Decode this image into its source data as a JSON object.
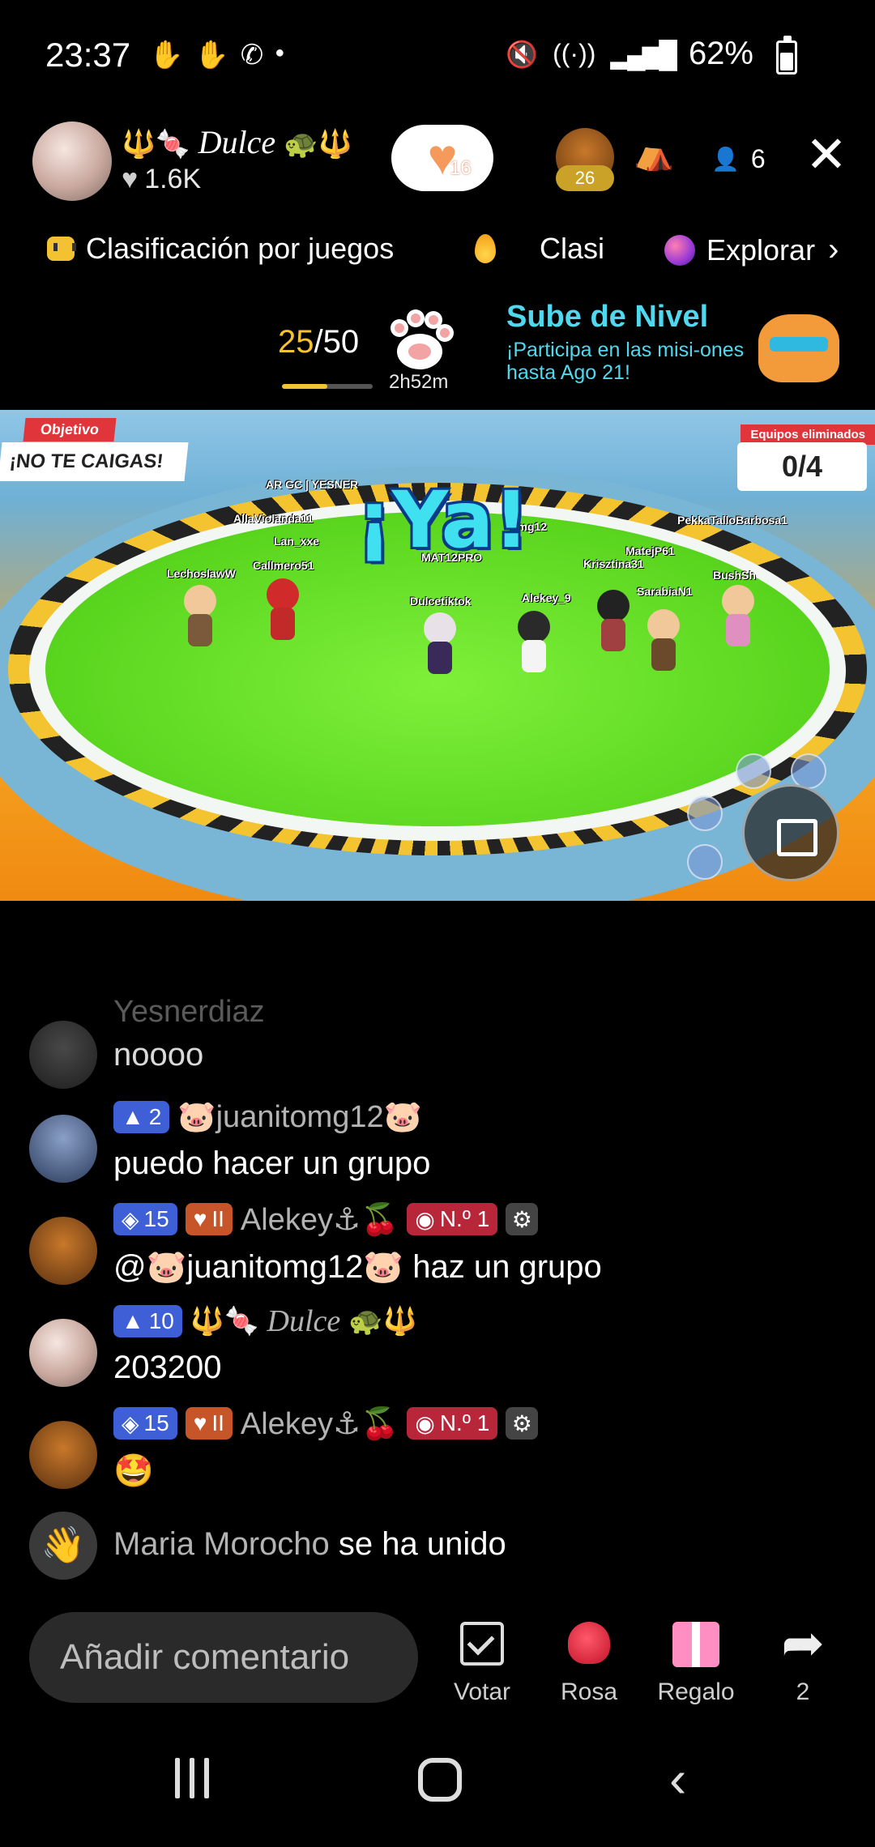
{
  "status_bar": {
    "time": "23:37",
    "left_icons": [
      "hand-icon",
      "hand-icon",
      "whatsapp-icon",
      "dot-icon"
    ],
    "battery": "62%",
    "battery_level_percent": 62
  },
  "header": {
    "host_name": "Dulce",
    "host_likes": "1.6K",
    "follow_badge_count": "16",
    "top_viewer_level": "26",
    "viewer_count": "6",
    "close_symbol": "✕"
  },
  "tabs": [
    {
      "label": "Clasificación por juegos",
      "icon": "gamepad-icon"
    },
    {
      "label": "Clasi",
      "icon": "fire-icon"
    },
    {
      "label": "Explorar",
      "icon": "planet-icon"
    }
  ],
  "progress": {
    "current": "25",
    "total": "/50",
    "fraction": 0.5,
    "timer": "2h52m",
    "promo_title": "Sube de Nivel",
    "promo_subtitle": "¡Participa en las misi-ones hasta Ago 21!"
  },
  "game": {
    "objective_label": "Objetivo",
    "objective_text": "¡NO TE CAIGAS!",
    "eliminated_label": "Equipos eliminados",
    "eliminated_value": "0/4",
    "go_text": "¡Ya!",
    "players": [
      "AR GC | YESNER",
      "AllaViolanda11",
      "Lan_xxe",
      "Callmero51",
      "LechoslawW",
      "MAT12PRO",
      "omg12",
      "Dulcetiktok",
      "Alekey_9",
      "Krisztina31",
      "MatejP61",
      "SarabiaN1",
      "PekkaTalloBarbosa1",
      "BushSh"
    ]
  },
  "chat": [
    {
      "user": "Yesnerdiaz",
      "text": "noooo",
      "badges": []
    },
    {
      "user": "🐷juanitomg12🐷",
      "text": "puedo hacer un grupo",
      "badges": [
        {
          "type": "level",
          "value": "2"
        }
      ]
    },
    {
      "user": "Alekey⚓🍒",
      "text": "@🐷juanitomg12🐷 haz un grupo",
      "badges": [
        {
          "type": "level",
          "value": "15"
        },
        {
          "type": "fan",
          "value": "II"
        },
        {
          "type": "rank",
          "value": "N.º 1"
        },
        {
          "type": "mod"
        }
      ]
    },
    {
      "user": "Dulce",
      "text": "203200",
      "badges": [
        {
          "type": "level",
          "value": "10"
        }
      ]
    },
    {
      "user": "Alekey⚓🍒",
      "text": "🤩",
      "badges": [
        {
          "type": "level",
          "value": "15"
        },
        {
          "type": "fan",
          "value": "II"
        },
        {
          "type": "rank",
          "value": "N.º 1"
        },
        {
          "type": "mod"
        }
      ]
    }
  ],
  "join_event": {
    "user": "Maria Morocho",
    "text": "se ha unido"
  },
  "bottom_bar": {
    "comment_placeholder": "Añadir comentario",
    "actions": [
      {
        "label": "Votar",
        "icon": "vote-icon"
      },
      {
        "label": "Rosa",
        "icon": "rose-icon"
      },
      {
        "label": "Regalo",
        "icon": "gift-icon"
      },
      {
        "label": "2",
        "icon": "share-icon"
      }
    ]
  }
}
